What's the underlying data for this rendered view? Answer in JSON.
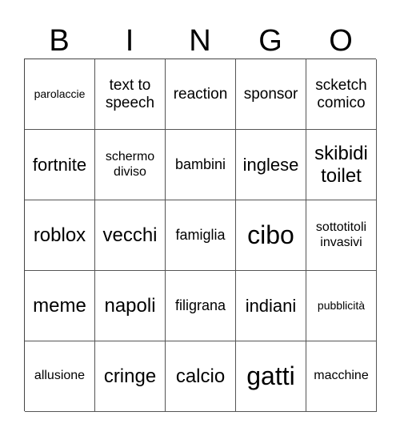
{
  "header": {
    "letters": [
      "B",
      "I",
      "N",
      "G",
      "O"
    ]
  },
  "board": {
    "rows": [
      [
        "parolaccie",
        "text to speech",
        "reaction",
        "sponsor",
        "scketch comico"
      ],
      [
        "fortnite",
        "schermo diviso",
        "bambini",
        "inglese",
        "skibidi toilet"
      ],
      [
        "roblox",
        "vecchi",
        "famiglia",
        "cibo",
        "sottotitoli invasivi"
      ],
      [
        "meme",
        "napoli",
        "filigrana",
        "indiani",
        "pubblicità"
      ],
      [
        "allusione",
        "cringe",
        "calcio",
        "gatti",
        "macchine"
      ]
    ]
  }
}
